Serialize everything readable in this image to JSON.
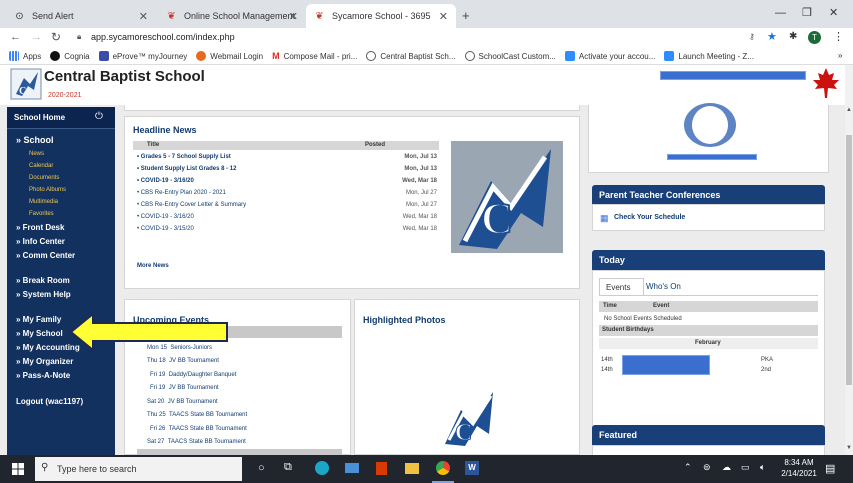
{
  "browser": {
    "tabs": [
      {
        "label": "Send Alert"
      },
      {
        "label": "Online School Management Syst"
      },
      {
        "label": "Sycamore School - 3695"
      }
    ],
    "new_tab": "+",
    "url": "app.sycamoreschool.com/index.php",
    "profile": "T",
    "bookmarks": [
      "Apps",
      "Cognia",
      "eProve™ myJourney",
      "Webmail Login",
      "Compose Mail - pri...",
      "Central Baptist Sch...",
      "SchoolCast Custom...",
      "Activate your accou...",
      "Launch Meeting - Z..."
    ],
    "bookmark_more": "»"
  },
  "school": {
    "name": "Central Baptist School",
    "year": "2020-2021"
  },
  "nav": {
    "home": "School Home",
    "section": "» School",
    "sub_items": [
      "News",
      "Calendar",
      "Documents",
      "Photo Albums",
      "Multimedia",
      "Favorites"
    ],
    "items_a": [
      "» Front Desk",
      "» Info Center",
      "» Comm Center"
    ],
    "items_b": [
      "» Break Room",
      "» System Help"
    ],
    "items_c": [
      "» My Family",
      "» My School",
      "» My Accounting",
      "» My Organizer",
      "» Pass-A-Note"
    ],
    "logout": "Logout (wac1197)"
  },
  "headline": {
    "title": "Headline News",
    "col_title": "Title",
    "col_posted": "Posted",
    "rows": [
      {
        "t": "Grades 5 - 7 School Supply List",
        "d": "Mon, Jul 13"
      },
      {
        "t": "Student Supply List Grades 8 - 12",
        "d": "Mon, Jul 13"
      },
      {
        "t": "COVID-19 - 3/16/20",
        "d": "Wed, Mar 18"
      },
      {
        "t": "CBS Re-Entry Plan 2020 - 2021",
        "d": "Mon, Jul 27"
      },
      {
        "t": "CBS Re-Entry Cover Letter & Summary",
        "d": "Mon, Jul 27"
      },
      {
        "t": "COVID-19 - 3/16/20",
        "d": "Wed, Mar 18"
      },
      {
        "t": "COVID-19 - 3/15/20",
        "d": "Wed, Mar 18"
      }
    ],
    "more": "More News"
  },
  "events": {
    "title": "Upcoming Events",
    "rows": [
      {
        "day": "Mon 15",
        "name": "Seniors-Juniors"
      },
      {
        "day": "Thu 18",
        "name": "JV BB Tournament"
      },
      {
        "day": "Fri 19",
        "name": "Daddy/Daughter Banquet"
      },
      {
        "day": "Fri 19",
        "name": "JV BB Tournament"
      },
      {
        "day": "Sat 20",
        "name": "JV BB Tournament"
      },
      {
        "day": "Thu 25",
        "name": "TAACS State BB Tournament"
      },
      {
        "day": "Fri 26",
        "name": "TAACS State BB Tournament"
      },
      {
        "day": "Sat 27",
        "name": "TAACS State BB Tournament"
      }
    ]
  },
  "photos": {
    "title": "Highlighted Photos"
  },
  "right": {
    "ptc_title": "Parent Teacher Conferences",
    "ptc_link": "Check Your Schedule",
    "today_title": "Today",
    "tab_events": "Events",
    "tab_whos_on": "Who's On",
    "col_time": "Time",
    "col_event": "Event",
    "no_events": "No School Events Scheduled",
    "birthdays": "Student Birthdays",
    "month": "February",
    "bdays": [
      {
        "day": "14th",
        "grade": "PKA"
      },
      {
        "day": "14th",
        "grade": "2nd"
      }
    ],
    "featured": "Featured"
  },
  "taskbar": {
    "search": "Type here to search",
    "time": "8:34 AM",
    "date": "2/14/2021"
  },
  "colors": {
    "nav": "#12315f",
    "accent": "#183f78",
    "arrow": "#ffff33",
    "logo_red": "#cc1111"
  }
}
